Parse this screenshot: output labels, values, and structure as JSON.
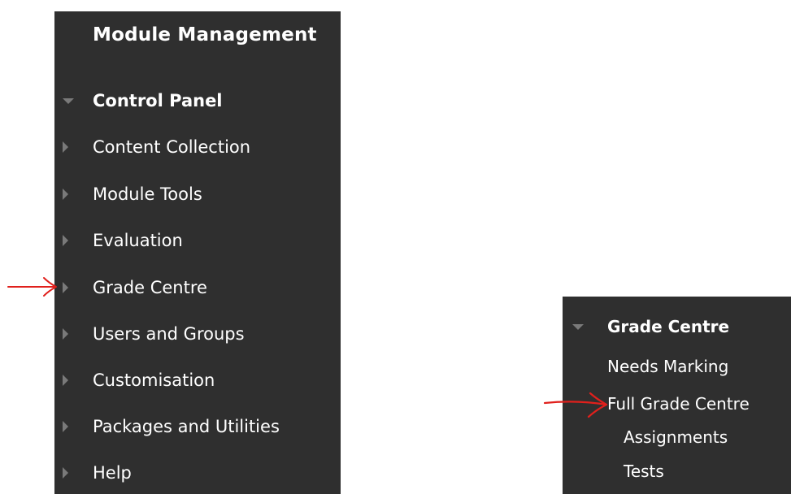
{
  "left_panel": {
    "title": "Module Management",
    "control_panel_label": "Control Panel",
    "items": [
      {
        "label": "Content Collection"
      },
      {
        "label": "Module Tools"
      },
      {
        "label": "Evaluation"
      },
      {
        "label": "Grade Centre"
      },
      {
        "label": "Users and Groups"
      },
      {
        "label": "Customisation"
      },
      {
        "label": "Packages and Utilities"
      },
      {
        "label": "Help"
      }
    ]
  },
  "right_panel": {
    "header_label": "Grade Centre",
    "items": [
      {
        "label": "Needs Marking"
      },
      {
        "label": "Full Grade Centre"
      },
      {
        "label": "Assignments"
      },
      {
        "label": "Tests"
      }
    ]
  },
  "colors": {
    "panel_bg": "#2f2f2f",
    "text": "#ffffff",
    "triangle": "#7a7a7a",
    "annotation_arrow": "#e0201c"
  },
  "icons": {
    "collapse": "triangle-down-icon",
    "expand": "triangle-right-icon",
    "annotation": "red-arrow-icon"
  }
}
